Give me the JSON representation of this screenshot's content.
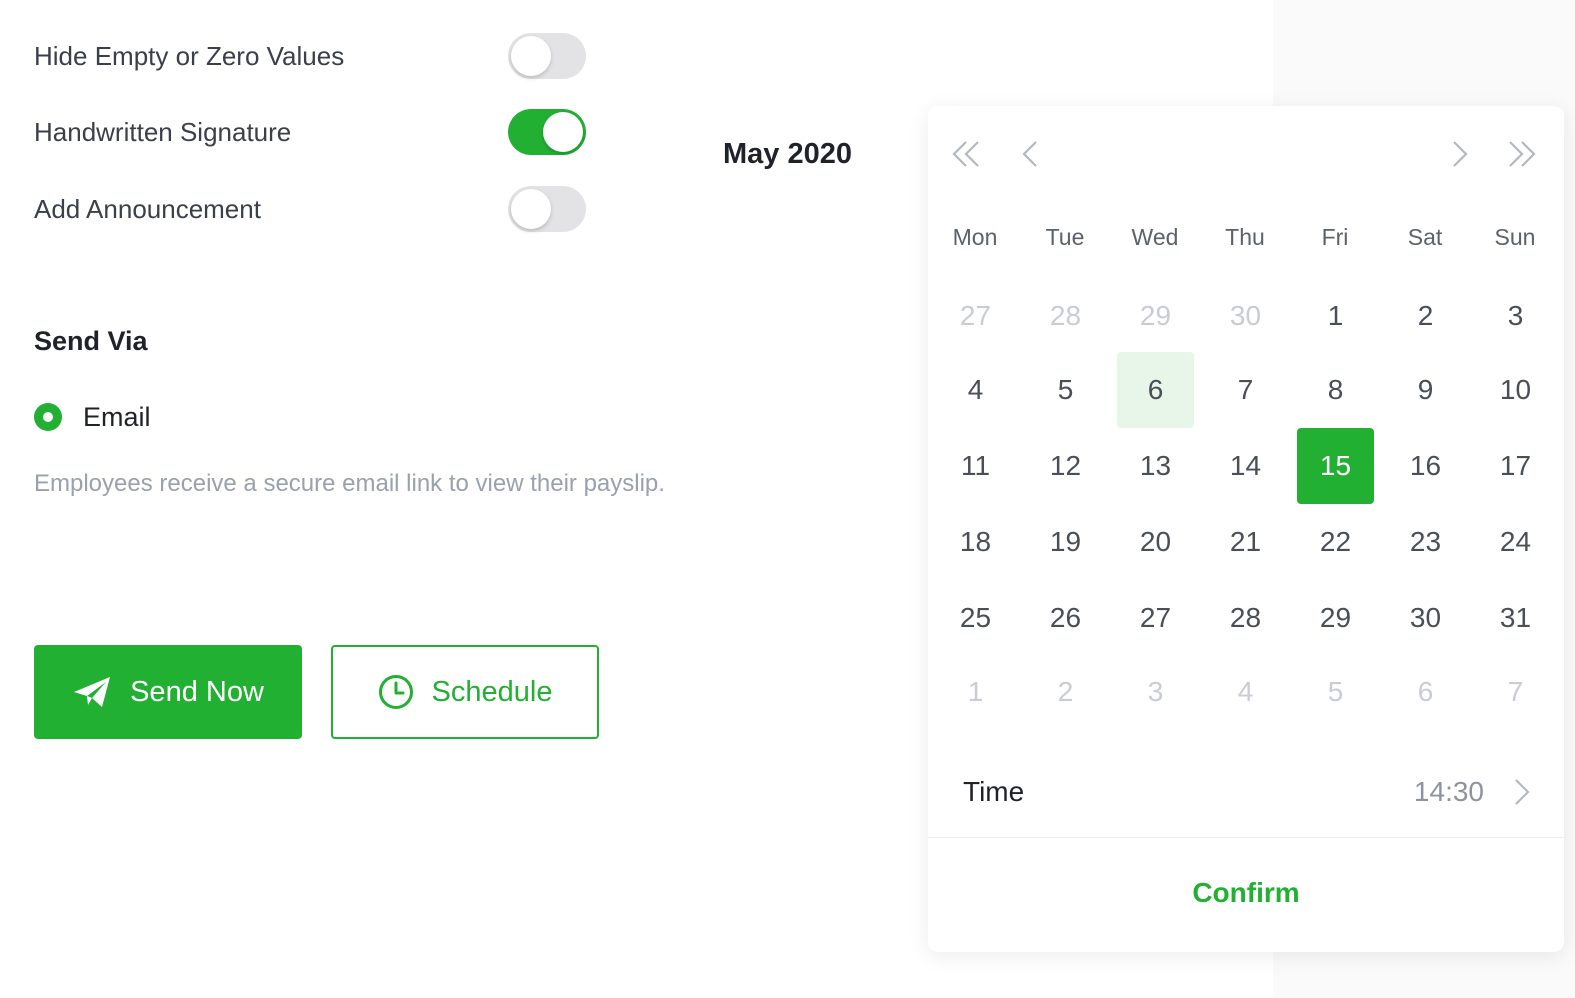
{
  "settings": [
    {
      "label": "Hide Empty or Zero Values",
      "on": false
    },
    {
      "label": "Handwritten Signature",
      "on": true
    },
    {
      "label": "Add Announcement",
      "on": false
    }
  ],
  "send_via": {
    "title": "Send Via",
    "option_label": "Email",
    "helper": "Employees receive a secure email link to view their payslip."
  },
  "actions": {
    "send_now_label": "Send Now",
    "send_now_icon": "paper-plane-icon",
    "schedule_label": "Schedule",
    "schedule_icon": "clock-icon"
  },
  "calendar": {
    "month_label": "May 2020",
    "weekdays": [
      "Mon",
      "Tue",
      "Wed",
      "Thu",
      "Fri",
      "Sat",
      "Sun"
    ],
    "weeks": [
      [
        "27",
        "28",
        "29",
        "30",
        "1",
        "2",
        "3"
      ],
      [
        "4",
        "5",
        "6",
        "7",
        "8",
        "9",
        "10"
      ],
      [
        "11",
        "12",
        "13",
        "14",
        "15",
        "16",
        "17"
      ],
      [
        "18",
        "19",
        "20",
        "21",
        "22",
        "23",
        "24"
      ],
      [
        "25",
        "26",
        "27",
        "28",
        "29",
        "30",
        "31"
      ],
      [
        "1",
        "2",
        "3",
        "4",
        "5",
        "6",
        "7"
      ]
    ],
    "today": "6",
    "selected": "15",
    "time_label": "Time",
    "time_value": "14:30",
    "confirm_label": "Confirm"
  },
  "colors": {
    "accent": "#22b033",
    "today_bg": "#e8f6ea",
    "muted_day": "#c9ccd2"
  }
}
